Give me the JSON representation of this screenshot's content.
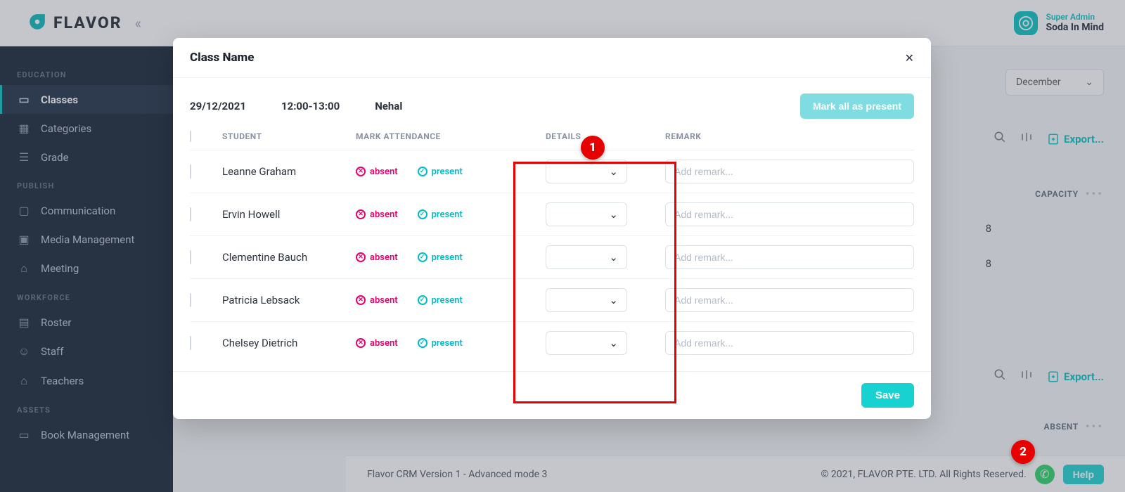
{
  "brand": {
    "name": "FLAVOR"
  },
  "user": {
    "role": "Super Admin",
    "name": "Soda In Mind"
  },
  "sidebar": {
    "sections": [
      {
        "label": "EDUCATION",
        "items": [
          {
            "label": "Classes",
            "icon": "book"
          },
          {
            "label": "Categories",
            "icon": "calendar"
          },
          {
            "label": "Grade",
            "icon": "grade"
          }
        ]
      },
      {
        "label": "PUBLISH",
        "items": [
          {
            "label": "Communication",
            "icon": "chat"
          },
          {
            "label": "Media Management",
            "icon": "media"
          },
          {
            "label": "Meeting",
            "icon": "meeting"
          }
        ]
      },
      {
        "label": "WORKFORCE",
        "items": [
          {
            "label": "Roster",
            "icon": "roster"
          },
          {
            "label": "Staff",
            "icon": "staff"
          },
          {
            "label": "Teachers",
            "icon": "teachers"
          }
        ]
      },
      {
        "label": "ASSETS",
        "items": [
          {
            "label": "Book Management",
            "icon": "book2"
          }
        ]
      }
    ]
  },
  "background": {
    "month_select": "December",
    "export": "Export...",
    "col_capacity": "CAPACITY",
    "cap1": "8",
    "cap2": "8",
    "col_absent": "ABSENT"
  },
  "modal": {
    "title": "Class Name",
    "date": "29/12/2021",
    "time": "12:00-13:00",
    "teacher": "Nehal",
    "mark_all": "Mark all as present",
    "headers": {
      "student": "STUDENT",
      "attendance": "MARK ATTENDANCE",
      "details": "DETAILS",
      "remark": "REMARK"
    },
    "labels": {
      "absent": "absent",
      "present": "present"
    },
    "remark_placeholder": "Add remark...",
    "save": "Save",
    "students": [
      {
        "name": "Leanne Graham"
      },
      {
        "name": "Ervin Howell"
      },
      {
        "name": "Clementine Bauch"
      },
      {
        "name": "Patricia Lebsack"
      },
      {
        "name": "Chelsey Dietrich"
      }
    ]
  },
  "footer": {
    "left": "Flavor CRM Version 1 - Advanced mode 3",
    "right": "© 2021, FLAVOR PTE. LTD. All Rights Reserved.",
    "help": "Help"
  },
  "annotations": {
    "b1": "1",
    "b2": "2"
  }
}
